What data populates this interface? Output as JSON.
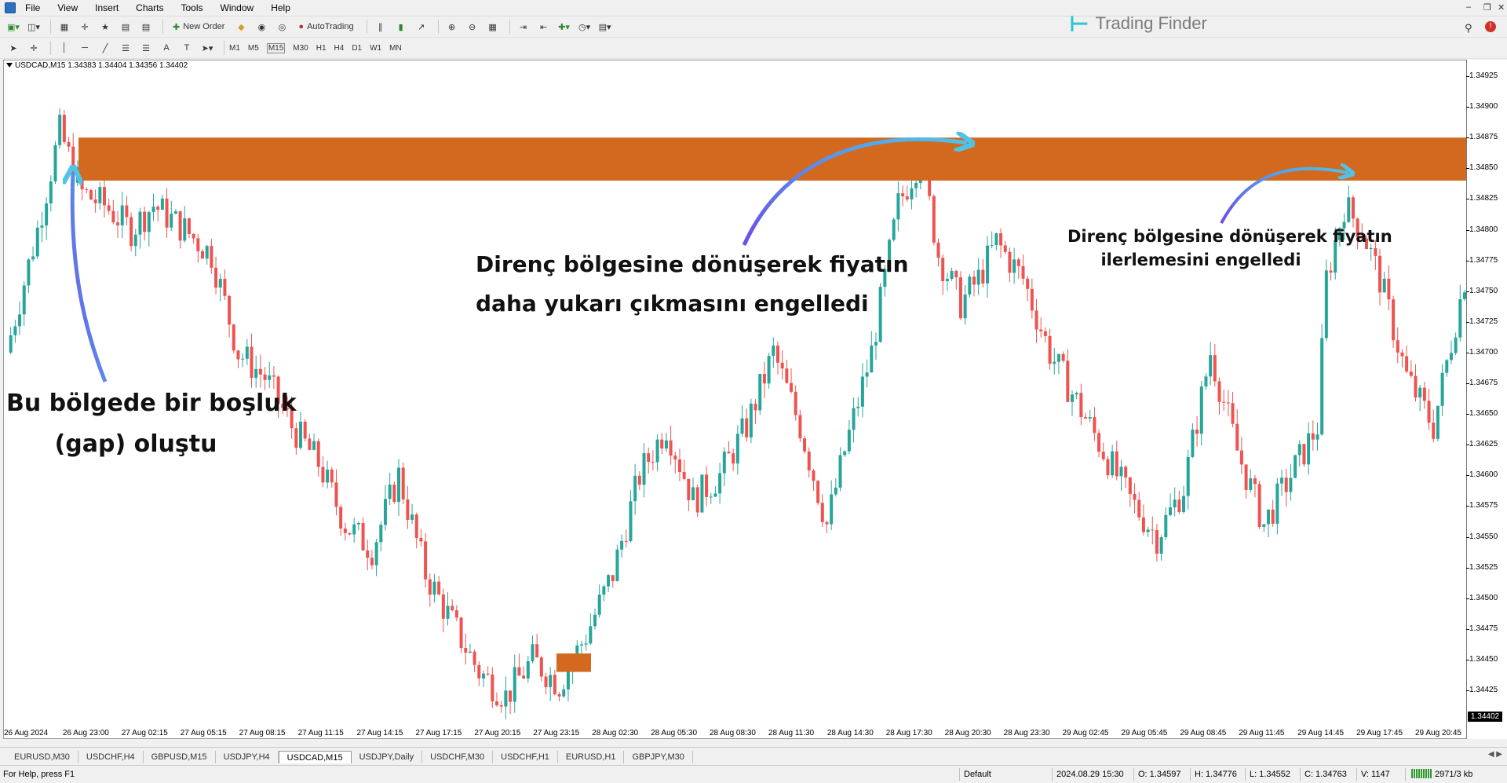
{
  "menu": {
    "items": [
      "File",
      "View",
      "Insert",
      "Charts",
      "Tools",
      "Window",
      "Help"
    ]
  },
  "toolbar": {
    "new_order": "New Order",
    "autotrading": "AutoTrading",
    "timeframes": [
      "M1",
      "M5",
      "M15",
      "M30",
      "H1",
      "H4",
      "D1",
      "W1",
      "MN"
    ]
  },
  "brand": {
    "name": "Trading Finder",
    "color": "#2ec4d6"
  },
  "chart": {
    "symbol_info": "USDCAD,M15  1.34383 1.34404 1.34356 1.34402",
    "current_price": "1.34402",
    "price_labels": [
      "1.34925",
      "1.34900",
      "1.34875",
      "1.34850",
      "1.34825",
      "1.34800",
      "1.34775",
      "1.34750",
      "1.34725",
      "1.34700",
      "1.34675",
      "1.34650",
      "1.34625",
      "1.34600",
      "1.34575",
      "1.34550",
      "1.34525",
      "1.34500",
      "1.34475",
      "1.34450",
      "1.34425"
    ],
    "time_labels": [
      "26 Aug 2024",
      "26 Aug 23:00",
      "27 Aug 02:15",
      "27 Aug 05:15",
      "27 Aug 08:15",
      "27 Aug 11:15",
      "27 Aug 14:15",
      "27 Aug 17:15",
      "27 Aug 20:15",
      "27 Aug 23:15",
      "28 Aug 02:30",
      "28 Aug 05:30",
      "28 Aug 08:30",
      "28 Aug 11:30",
      "28 Aug 14:30",
      "28 Aug 17:30",
      "28 Aug 20:30",
      "28 Aug 23:30",
      "29 Aug 02:45",
      "29 Aug 05:45",
      "29 Aug 08:45",
      "29 Aug 11:45",
      "29 Aug 14:45",
      "29 Aug 17:45",
      "29 Aug 20:45"
    ],
    "colors": {
      "bull": "#26a69a",
      "bear": "#ef5350",
      "zone": "#d2691e",
      "arrow_start": "#4fc3e8",
      "arrow_end": "#6a4ee8"
    }
  },
  "chart_data": {
    "type": "candlestick",
    "symbol": "USDCAD",
    "timeframe": "M15",
    "ylim": [
      1.344,
      1.34935
    ],
    "resistance_zone": [
      1.3484,
      1.34875
    ],
    "small_zone": [
      1.3444,
      1.34455
    ],
    "path": [
      [
        0,
        1.347
      ],
      [
        7,
        1.348
      ],
      [
        12,
        1.3488
      ],
      [
        17,
        1.3483
      ],
      [
        22,
        1.3482
      ],
      [
        28,
        1.348
      ],
      [
        33,
        1.3482
      ],
      [
        40,
        1.348
      ],
      [
        46,
        1.3478
      ],
      [
        52,
        1.347
      ],
      [
        58,
        1.3468
      ],
      [
        64,
        1.3464
      ],
      [
        70,
        1.3461
      ],
      [
        76,
        1.3456
      ],
      [
        82,
        1.3454
      ],
      [
        88,
        1.346
      ],
      [
        94,
        1.3452
      ],
      [
        100,
        1.3448
      ],
      [
        106,
        1.3444
      ],
      [
        112,
        1.3442
      ],
      [
        118,
        1.3445
      ],
      [
        124,
        1.3443
      ],
      [
        130,
        1.3447
      ],
      [
        136,
        1.3452
      ],
      [
        142,
        1.346
      ],
      [
        148,
        1.3464
      ],
      [
        154,
        1.3458
      ],
      [
        160,
        1.346
      ],
      [
        166,
        1.3464
      ],
      [
        172,
        1.347
      ],
      [
        178,
        1.3464
      ],
      [
        184,
        1.3456
      ],
      [
        188,
        1.3462
      ],
      [
        194,
        1.347
      ],
      [
        200,
        1.3482
      ],
      [
        205,
        1.3486
      ],
      [
        209,
        1.3478
      ],
      [
        214,
        1.3474
      ],
      [
        218,
        1.3476
      ],
      [
        222,
        1.3479
      ],
      [
        228,
        1.3476
      ],
      [
        234,
        1.347
      ],
      [
        240,
        1.3466
      ],
      [
        246,
        1.3462
      ],
      [
        252,
        1.3458
      ],
      [
        258,
        1.3455
      ],
      [
        264,
        1.3459
      ],
      [
        270,
        1.347
      ],
      [
        276,
        1.3462
      ],
      [
        282,
        1.3456
      ],
      [
        288,
        1.346
      ],
      [
        294,
        1.3464
      ],
      [
        296,
        1.3476
      ],
      [
        300,
        1.3482
      ],
      [
        304,
        1.348
      ],
      [
        308,
        1.3476
      ],
      [
        314,
        1.3468
      ],
      [
        320,
        1.3464
      ],
      [
        327,
        1.3476
      ]
    ],
    "annotations": [
      {
        "lines": [
          "Bu bölgede bir boşluk",
          "(gap) oluştu"
        ]
      },
      {
        "lines": [
          "Direnç bölgesine dönüşerek fiyatın",
          "daha yukarı çıkmasını engelledi"
        ]
      },
      {
        "lines": [
          "Direnç bölgesine dönüşerek fiyatın",
          "ilerlemesini engelledi"
        ]
      }
    ]
  },
  "tabs": {
    "items": [
      "EURUSD,M30",
      "USDCHF,H4",
      "GBPUSD,M15",
      "USDJPY,H4",
      "USDCAD,M15",
      "USDJPY,Daily",
      "USDCHF,M30",
      "USDCHF,H1",
      "EURUSD,H1",
      "GBPJPY,M30"
    ],
    "active": "USDCAD,M15"
  },
  "status": {
    "help": "For Help, press F1",
    "profile": "Default",
    "datetime": "2024.08.29 15:30",
    "open": "O: 1.34597",
    "high": "H: 1.34776",
    "low": "L: 1.34552",
    "close": "C: 1.34763",
    "volume": "V: 1147",
    "traffic": "2971/3 kb"
  }
}
